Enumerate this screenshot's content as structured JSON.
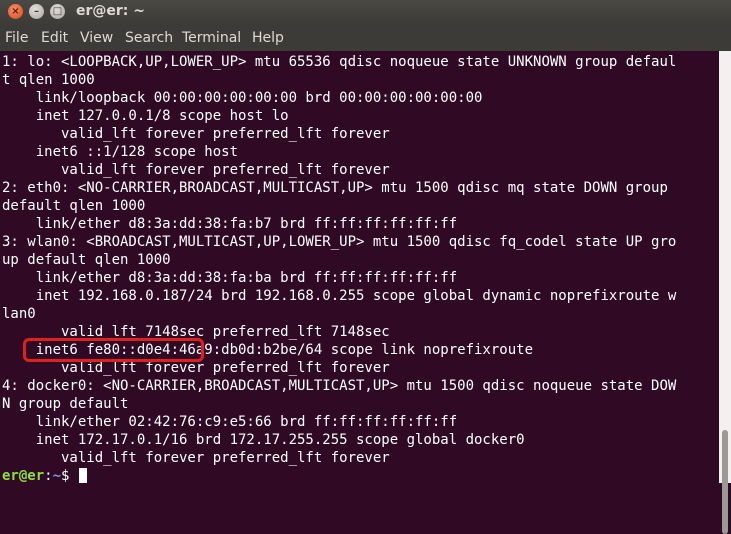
{
  "window": {
    "title": "er@er: ~",
    "close": "×",
    "minimize": "–",
    "maximize": "□"
  },
  "menu": {
    "file": "File",
    "edit": "Edit",
    "view": "View",
    "search": "Search",
    "terminal": "Terminal",
    "help": "Help"
  },
  "terminal": {
    "lines": [
      "1: lo: <LOOPBACK,UP,LOWER_UP> mtu 65536 qdisc noqueue state UNKNOWN group defaul",
      "t qlen 1000",
      "    link/loopback 00:00:00:00:00:00 brd 00:00:00:00:00:00",
      "    inet 127.0.0.1/8 scope host lo",
      "       valid_lft forever preferred_lft forever",
      "    inet6 ::1/128 scope host",
      "       valid_lft forever preferred_lft forever",
      "2: eth0: <NO-CARRIER,BROADCAST,MULTICAST,UP> mtu 1500 qdisc mq state DOWN group",
      "default qlen 1000",
      "    link/ether d8:3a:dd:38:fa:b7 brd ff:ff:ff:ff:ff:ff",
      "3: wlan0: <BROADCAST,MULTICAST,UP,LOWER_UP> mtu 1500 qdisc fq_codel state UP gro",
      "up default qlen 1000",
      "    link/ether d8:3a:dd:38:fa:ba brd ff:ff:ff:ff:ff:ff",
      "    inet 192.168.0.187/24 brd 192.168.0.255 scope global dynamic noprefixroute w",
      "lan0",
      "       valid_lft 7148sec preferred_lft 7148sec",
      "    inet6 fe80::d0e4:46a9:db0d:b2be/64 scope link noprefixroute",
      "       valid_lft forever preferred_lft forever",
      "4: docker0: <NO-CARRIER,BROADCAST,MULTICAST,UP> mtu 1500 qdisc noqueue state DOW",
      "N group default",
      "    link/ether 02:42:76:c9:e5:66 brd ff:ff:ff:ff:ff:ff",
      "    inet 172.17.0.1/16 brd 172.17.255.255 scope global docker0",
      "       valid_lft forever preferred_lft forever"
    ],
    "prompt": {
      "user": "er@er",
      "path": "~",
      "symbol": "$ "
    }
  },
  "colors": {
    "background": "#300a24",
    "text": "#ffffff",
    "prompt_user": "#8ae234",
    "prompt_path": "#729fcf",
    "highlight": "#e02020"
  }
}
